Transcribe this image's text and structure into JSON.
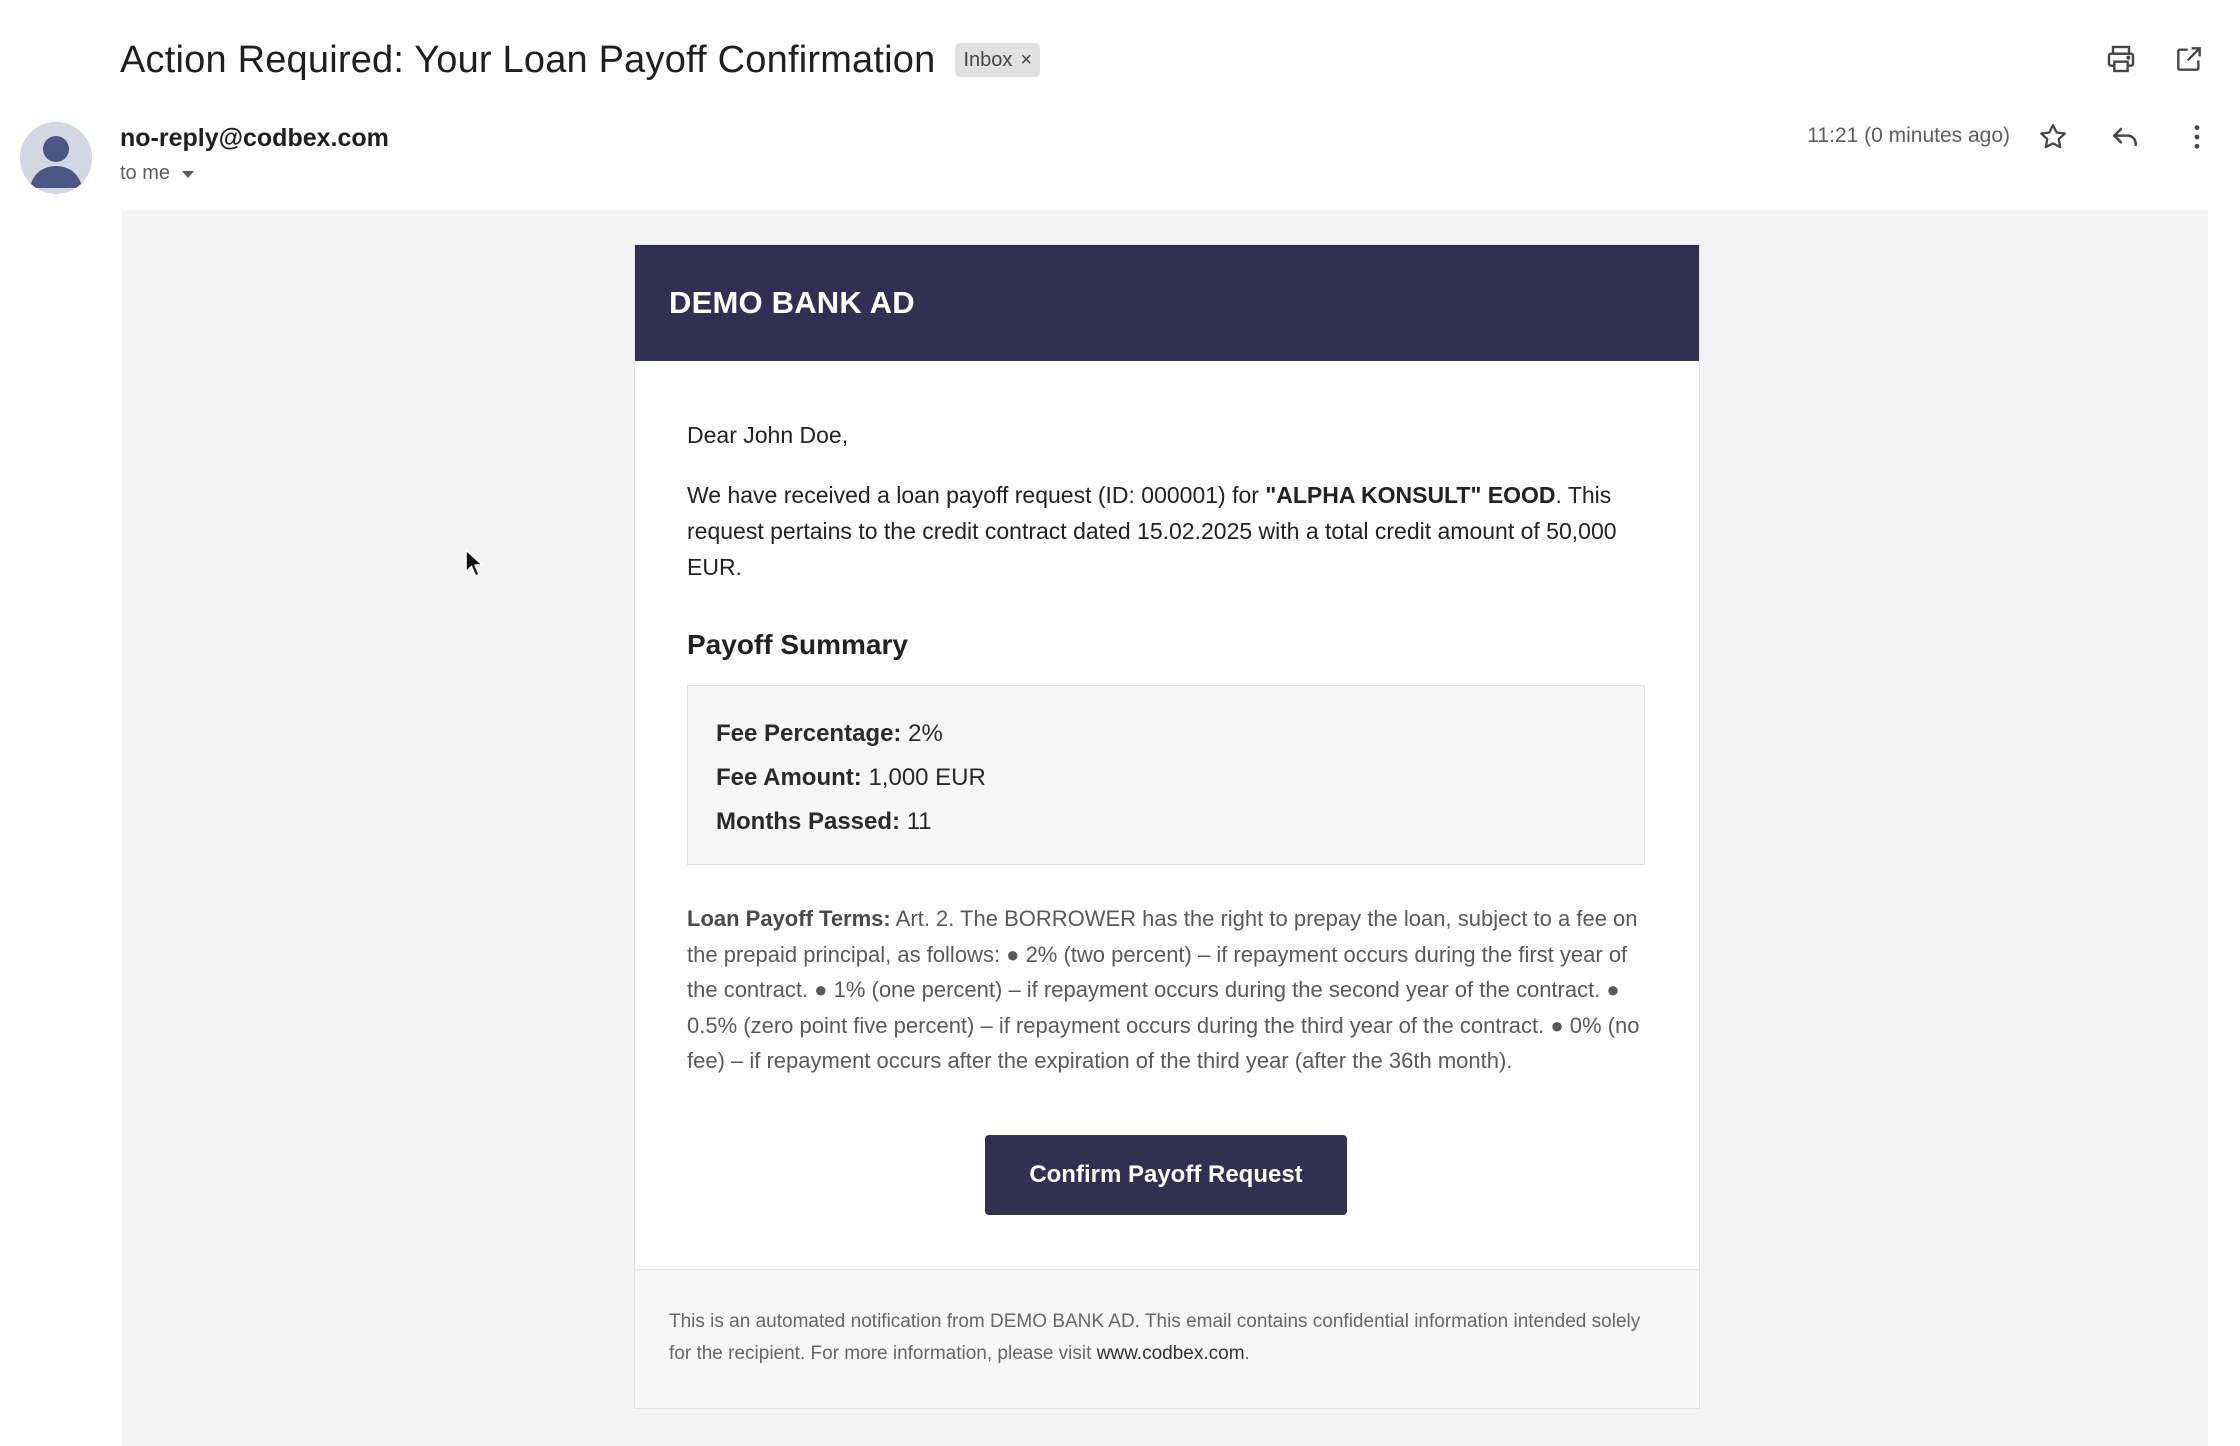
{
  "message": {
    "subject": "Action Required: Your Loan Payoff Confirmation",
    "label": "Inbox",
    "label_remove": "×",
    "sender": "no-reply@codbex.com",
    "recipient": "to me",
    "timestamp": "11:21 (0 minutes ago)"
  },
  "icons": {
    "print": "print-icon",
    "open_new_window": "open-in-new-window-icon",
    "star": "star-icon",
    "reply": "reply-icon",
    "more": "more-vert-icon",
    "avatar": "avatar-icon"
  },
  "email": {
    "bank_name": "DEMO BANK AD",
    "greeting": "Dear John Doe,",
    "intro_pre": "We have received a loan payoff request (ID: 000001) for ",
    "intro_company": "\"ALPHA KONSULT\" EOOD",
    "intro_post": ". This request pertains to the credit contract dated 15.02.2025 with a total credit amount of 50,000 EUR.",
    "summary_title": "Payoff Summary",
    "summary": [
      {
        "label": "Fee Percentage:",
        "value": " 2%"
      },
      {
        "label": "Fee Amount:",
        "value": " 1,000 EUR"
      },
      {
        "label": "Months Passed:",
        "value": " 11"
      }
    ],
    "terms_label": "Loan Payoff Terms:",
    "terms_text": " Art. 2. The BORROWER has the right to prepay the loan, subject to a fee on the prepaid principal, as follows: ● 2% (two percent) – if repayment occurs during the first year of the contract. ● 1% (one percent) – if repayment occurs during the second year of the contract. ● 0.5% (zero point five percent) – if repayment occurs during the third year of the contract. ● 0% (no fee) – if repayment occurs after the expiration of the third year (after the 36th month).",
    "button_label": "Confirm Payoff Request",
    "footer_text": "This is an automated notification from DEMO BANK AD. This email contains confidential information intended solely for the recipient. For more information, please visit ",
    "footer_link": "www.codbex.com",
    "footer_end": "."
  },
  "colors": {
    "brand": "#332f52",
    "canvas": "#f4f4f4",
    "footer_bg": "#f7f7f7"
  }
}
